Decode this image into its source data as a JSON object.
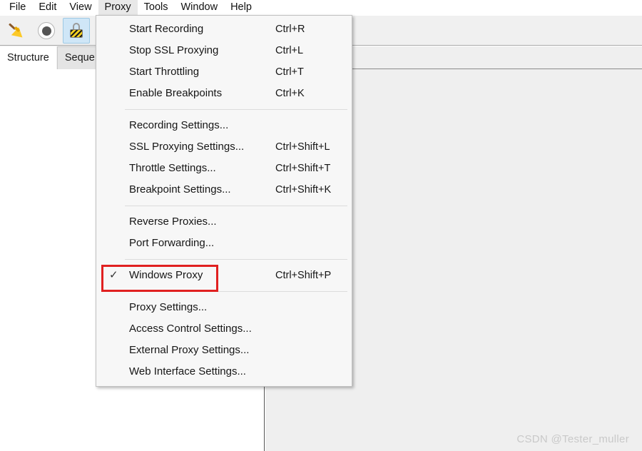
{
  "menubar": {
    "items": [
      {
        "label": "File",
        "open": false
      },
      {
        "label": "Edit",
        "open": false
      },
      {
        "label": "View",
        "open": false
      },
      {
        "label": "Proxy",
        "open": true
      },
      {
        "label": "Tools",
        "open": false
      },
      {
        "label": "Window",
        "open": false
      },
      {
        "label": "Help",
        "open": false
      }
    ]
  },
  "toolbar": {
    "buttons": [
      {
        "name": "clear-button",
        "icon": "broom-icon",
        "selected": false
      },
      {
        "name": "record-button",
        "icon": "record-icon",
        "selected": false
      },
      {
        "name": "ssl-proxying-button",
        "icon": "ssl-lock-icon",
        "selected": true
      }
    ]
  },
  "tabs": [
    {
      "label": "Structure",
      "active": true
    },
    {
      "label": "Seque",
      "active": false
    }
  ],
  "proxy_menu": {
    "title": "Proxy",
    "groups": [
      {
        "items": [
          {
            "label": "Start Recording",
            "shortcut": "Ctrl+R",
            "checked": false,
            "highlighted": false
          },
          {
            "label": "Stop SSL Proxying",
            "shortcut": "Ctrl+L",
            "checked": false,
            "highlighted": false
          },
          {
            "label": "Start Throttling",
            "shortcut": "Ctrl+T",
            "checked": false,
            "highlighted": false
          },
          {
            "label": "Enable Breakpoints",
            "shortcut": "Ctrl+K",
            "checked": false,
            "highlighted": false
          }
        ]
      },
      {
        "items": [
          {
            "label": "Recording Settings...",
            "shortcut": "",
            "checked": false,
            "highlighted": false
          },
          {
            "label": "SSL Proxying Settings...",
            "shortcut": "Ctrl+Shift+L",
            "checked": false,
            "highlighted": false
          },
          {
            "label": "Throttle Settings...",
            "shortcut": "Ctrl+Shift+T",
            "checked": false,
            "highlighted": false
          },
          {
            "label": "Breakpoint Settings...",
            "shortcut": "Ctrl+Shift+K",
            "checked": false,
            "highlighted": false
          }
        ]
      },
      {
        "items": [
          {
            "label": "Reverse Proxies...",
            "shortcut": "",
            "checked": false,
            "highlighted": false
          },
          {
            "label": "Port Forwarding...",
            "shortcut": "",
            "checked": false,
            "highlighted": false
          }
        ]
      },
      {
        "items": [
          {
            "label": "Windows Proxy",
            "shortcut": "Ctrl+Shift+P",
            "checked": true,
            "highlighted": true
          }
        ]
      },
      {
        "items": [
          {
            "label": "Proxy Settings...",
            "shortcut": "",
            "checked": false,
            "highlighted": false
          },
          {
            "label": "Access Control Settings...",
            "shortcut": "",
            "checked": false,
            "highlighted": false
          },
          {
            "label": "External Proxy Settings...",
            "shortcut": "",
            "checked": false,
            "highlighted": false
          },
          {
            "label": "Web Interface Settings...",
            "shortcut": "",
            "checked": false,
            "highlighted": false
          }
        ]
      }
    ]
  },
  "watermark": {
    "text": "CSDN @Tester_muller"
  },
  "colors": {
    "highlight_box": "#e02020",
    "selected_tool": "#cfe6f7",
    "menu_bg": "#f7f7f7",
    "pane_bg": "#efefef"
  },
  "check_glyph": "✓"
}
